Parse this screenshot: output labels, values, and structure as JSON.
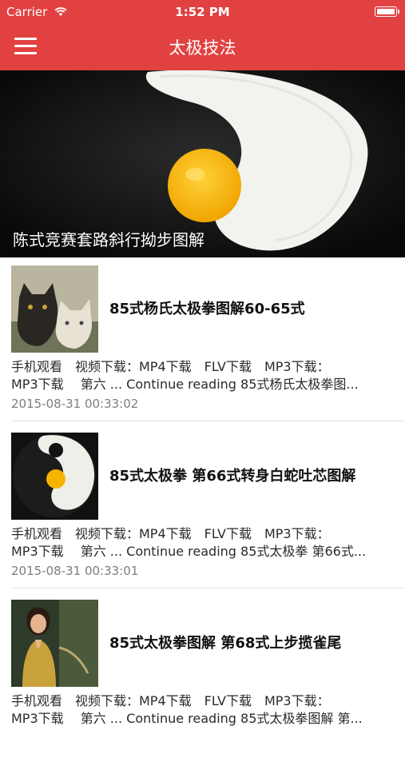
{
  "status_bar": {
    "carrier": "Carrier",
    "time": "1:52 PM"
  },
  "nav": {
    "title": "太极技法"
  },
  "hero": {
    "title": "陈式竞赛套路斜行拗步图解"
  },
  "list": [
    {
      "title": "85式杨氏太极拳图解60-65式",
      "desc_line1": "手机观看　视频下载：MP4下载　FLV下载　MP3下载：",
      "desc_line2": "MP3下载　 第六 ... Continue reading 85式杨氏太极拳图...",
      "date": "2015-08-31 00:33:02"
    },
    {
      "title": "85式太极拳 第66式转身白蛇吐芯图解",
      "desc_line1": "手机观看　视频下载：MP4下载　FLV下载　MP3下载：",
      "desc_line2": "MP3下载　 第六 ... Continue reading 85式太极拳 第66式...",
      "date": "2015-08-31 00:33:01"
    },
    {
      "title": "85式太极拳图解 第68式上步揽雀尾",
      "desc_line1": "手机观看　视频下载：MP4下载　FLV下载　MP3下载：",
      "desc_line2": "MP3下载　 第六 ... Continue reading 85式太极拳图解 第...",
      "date": ""
    }
  ],
  "colors": {
    "accent": "#e14141",
    "date_text": "#7d7d7d",
    "separator": "#e3e3e3"
  },
  "icons": {
    "menu": "hamburger-menu-icon",
    "wifi": "wifi-icon",
    "battery": "battery-icon"
  }
}
